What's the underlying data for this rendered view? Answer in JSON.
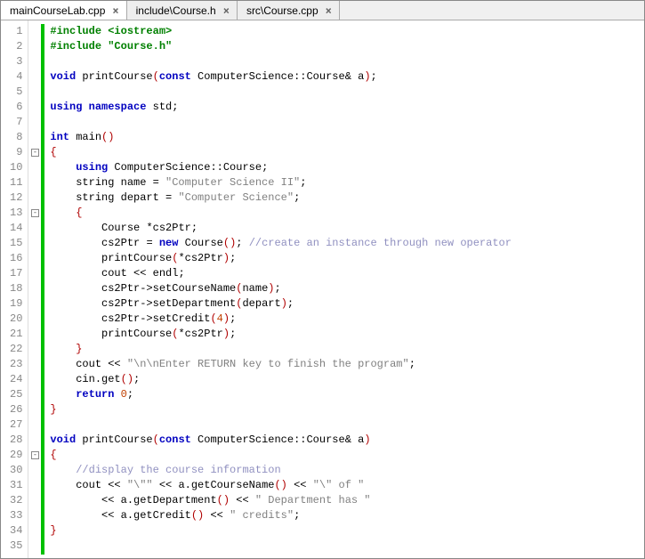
{
  "tabs": [
    {
      "label": "mainCourseLab.cpp",
      "active": true
    },
    {
      "label": "include\\Course.h",
      "active": false
    },
    {
      "label": "src\\Course.cpp",
      "active": false
    }
  ],
  "fold_markers": {
    "9": "-",
    "13": "-",
    "29": "-"
  },
  "code_lines": [
    [
      {
        "c": "tok-pp",
        "t": "#include <iostream>"
      }
    ],
    [
      {
        "c": "tok-pp",
        "t": "#include \"Course.h\""
      }
    ],
    [],
    [
      {
        "c": "tok-kw",
        "t": "void"
      },
      {
        "c": "tok-txt",
        "t": " printCourse"
      },
      {
        "c": "tok-brace",
        "t": "("
      },
      {
        "c": "tok-kw",
        "t": "const"
      },
      {
        "c": "tok-txt",
        "t": " ComputerScience"
      },
      {
        "c": "tok-op",
        "t": "::"
      },
      {
        "c": "tok-txt",
        "t": "Course"
      },
      {
        "c": "tok-op",
        "t": "&"
      },
      {
        "c": "tok-txt",
        "t": " a"
      },
      {
        "c": "tok-brace",
        "t": ")"
      },
      {
        "c": "tok-op",
        "t": ";"
      }
    ],
    [],
    [
      {
        "c": "tok-kw",
        "t": "using"
      },
      {
        "c": "tok-txt",
        "t": " "
      },
      {
        "c": "tok-kw",
        "t": "namespace"
      },
      {
        "c": "tok-txt",
        "t": " std"
      },
      {
        "c": "tok-op",
        "t": ";"
      }
    ],
    [],
    [
      {
        "c": "tok-kw",
        "t": "int"
      },
      {
        "c": "tok-txt",
        "t": " main"
      },
      {
        "c": "tok-brace",
        "t": "()"
      }
    ],
    [
      {
        "c": "tok-brace",
        "t": "{"
      }
    ],
    [
      {
        "c": "tok-txt",
        "t": "    "
      },
      {
        "c": "tok-kw",
        "t": "using"
      },
      {
        "c": "tok-txt",
        "t": " ComputerScience"
      },
      {
        "c": "tok-op",
        "t": "::"
      },
      {
        "c": "tok-txt",
        "t": "Course"
      },
      {
        "c": "tok-op",
        "t": ";"
      }
    ],
    [
      {
        "c": "tok-txt",
        "t": "    string name "
      },
      {
        "c": "tok-op",
        "t": "="
      },
      {
        "c": "tok-txt",
        "t": " "
      },
      {
        "c": "tok-str",
        "t": "\"Computer Science II\""
      },
      {
        "c": "tok-op",
        "t": ";"
      }
    ],
    [
      {
        "c": "tok-txt",
        "t": "    string depart "
      },
      {
        "c": "tok-op",
        "t": "="
      },
      {
        "c": "tok-txt",
        "t": " "
      },
      {
        "c": "tok-str",
        "t": "\"Computer Science\""
      },
      {
        "c": "tok-op",
        "t": ";"
      }
    ],
    [
      {
        "c": "tok-txt",
        "t": "    "
      },
      {
        "c": "tok-brace",
        "t": "{"
      }
    ],
    [
      {
        "c": "tok-txt",
        "t": "        Course "
      },
      {
        "c": "tok-op",
        "t": "*"
      },
      {
        "c": "tok-txt",
        "t": "cs2Ptr"
      },
      {
        "c": "tok-op",
        "t": ";"
      }
    ],
    [
      {
        "c": "tok-txt",
        "t": "        cs2Ptr "
      },
      {
        "c": "tok-op",
        "t": "="
      },
      {
        "c": "tok-txt",
        "t": " "
      },
      {
        "c": "tok-kw",
        "t": "new"
      },
      {
        "c": "tok-txt",
        "t": " Course"
      },
      {
        "c": "tok-brace",
        "t": "()"
      },
      {
        "c": "tok-op",
        "t": ";"
      },
      {
        "c": "tok-txt",
        "t": " "
      },
      {
        "c": "tok-cmt",
        "t": "//create an instance through new operator"
      }
    ],
    [
      {
        "c": "tok-txt",
        "t": "        printCourse"
      },
      {
        "c": "tok-brace",
        "t": "("
      },
      {
        "c": "tok-op",
        "t": "*"
      },
      {
        "c": "tok-txt",
        "t": "cs2Ptr"
      },
      {
        "c": "tok-brace",
        "t": ")"
      },
      {
        "c": "tok-op",
        "t": ";"
      }
    ],
    [
      {
        "c": "tok-txt",
        "t": "        cout "
      },
      {
        "c": "tok-op",
        "t": "<<"
      },
      {
        "c": "tok-txt",
        "t": " endl"
      },
      {
        "c": "tok-op",
        "t": ";"
      }
    ],
    [
      {
        "c": "tok-txt",
        "t": "        cs2Ptr"
      },
      {
        "c": "tok-op",
        "t": "->"
      },
      {
        "c": "tok-txt",
        "t": "setCourseName"
      },
      {
        "c": "tok-brace",
        "t": "("
      },
      {
        "c": "tok-txt",
        "t": "name"
      },
      {
        "c": "tok-brace",
        "t": ")"
      },
      {
        "c": "tok-op",
        "t": ";"
      }
    ],
    [
      {
        "c": "tok-txt",
        "t": "        cs2Ptr"
      },
      {
        "c": "tok-op",
        "t": "->"
      },
      {
        "c": "tok-txt",
        "t": "setDepartment"
      },
      {
        "c": "tok-brace",
        "t": "("
      },
      {
        "c": "tok-txt",
        "t": "depart"
      },
      {
        "c": "tok-brace",
        "t": ")"
      },
      {
        "c": "tok-op",
        "t": ";"
      }
    ],
    [
      {
        "c": "tok-txt",
        "t": "        cs2Ptr"
      },
      {
        "c": "tok-op",
        "t": "->"
      },
      {
        "c": "tok-txt",
        "t": "setCredit"
      },
      {
        "c": "tok-brace",
        "t": "("
      },
      {
        "c": "tok-num",
        "t": "4"
      },
      {
        "c": "tok-brace",
        "t": ")"
      },
      {
        "c": "tok-op",
        "t": ";"
      }
    ],
    [
      {
        "c": "tok-txt",
        "t": "        printCourse"
      },
      {
        "c": "tok-brace",
        "t": "("
      },
      {
        "c": "tok-op",
        "t": "*"
      },
      {
        "c": "tok-txt",
        "t": "cs2Ptr"
      },
      {
        "c": "tok-brace",
        "t": ")"
      },
      {
        "c": "tok-op",
        "t": ";"
      }
    ],
    [
      {
        "c": "tok-txt",
        "t": "    "
      },
      {
        "c": "tok-brace",
        "t": "}"
      }
    ],
    [
      {
        "c": "tok-txt",
        "t": "    cout "
      },
      {
        "c": "tok-op",
        "t": "<<"
      },
      {
        "c": "tok-txt",
        "t": " "
      },
      {
        "c": "tok-str",
        "t": "\"\\n\\nEnter RETURN key to finish the program\""
      },
      {
        "c": "tok-op",
        "t": ";"
      }
    ],
    [
      {
        "c": "tok-txt",
        "t": "    cin"
      },
      {
        "c": "tok-op",
        "t": "."
      },
      {
        "c": "tok-txt",
        "t": "get"
      },
      {
        "c": "tok-brace",
        "t": "()"
      },
      {
        "c": "tok-op",
        "t": ";"
      }
    ],
    [
      {
        "c": "tok-txt",
        "t": "    "
      },
      {
        "c": "tok-kw",
        "t": "return"
      },
      {
        "c": "tok-txt",
        "t": " "
      },
      {
        "c": "tok-num",
        "t": "0"
      },
      {
        "c": "tok-op",
        "t": ";"
      }
    ],
    [
      {
        "c": "tok-brace",
        "t": "}"
      }
    ],
    [],
    [
      {
        "c": "tok-kw",
        "t": "void"
      },
      {
        "c": "tok-txt",
        "t": " printCourse"
      },
      {
        "c": "tok-brace",
        "t": "("
      },
      {
        "c": "tok-kw",
        "t": "const"
      },
      {
        "c": "tok-txt",
        "t": " ComputerScience"
      },
      {
        "c": "tok-op",
        "t": "::"
      },
      {
        "c": "tok-txt",
        "t": "Course"
      },
      {
        "c": "tok-op",
        "t": "&"
      },
      {
        "c": "tok-txt",
        "t": " a"
      },
      {
        "c": "tok-brace",
        "t": ")"
      }
    ],
    [
      {
        "c": "tok-brace",
        "t": "{"
      }
    ],
    [
      {
        "c": "tok-txt",
        "t": "    "
      },
      {
        "c": "tok-cmt",
        "t": "//display the course information"
      }
    ],
    [
      {
        "c": "tok-txt",
        "t": "    cout "
      },
      {
        "c": "tok-op",
        "t": "<<"
      },
      {
        "c": "tok-txt",
        "t": " "
      },
      {
        "c": "tok-str",
        "t": "\"\\\"\""
      },
      {
        "c": "tok-txt",
        "t": " "
      },
      {
        "c": "tok-op",
        "t": "<<"
      },
      {
        "c": "tok-txt",
        "t": " a"
      },
      {
        "c": "tok-op",
        "t": "."
      },
      {
        "c": "tok-txt",
        "t": "getCourseName"
      },
      {
        "c": "tok-brace",
        "t": "()"
      },
      {
        "c": "tok-txt",
        "t": " "
      },
      {
        "c": "tok-op",
        "t": "<<"
      },
      {
        "c": "tok-txt",
        "t": " "
      },
      {
        "c": "tok-str",
        "t": "\"\\\" of \""
      }
    ],
    [
      {
        "c": "tok-txt",
        "t": "        "
      },
      {
        "c": "tok-op",
        "t": "<<"
      },
      {
        "c": "tok-txt",
        "t": " a"
      },
      {
        "c": "tok-op",
        "t": "."
      },
      {
        "c": "tok-txt",
        "t": "getDepartment"
      },
      {
        "c": "tok-brace",
        "t": "()"
      },
      {
        "c": "tok-txt",
        "t": " "
      },
      {
        "c": "tok-op",
        "t": "<<"
      },
      {
        "c": "tok-txt",
        "t": " "
      },
      {
        "c": "tok-str",
        "t": "\" Department has \""
      }
    ],
    [
      {
        "c": "tok-txt",
        "t": "        "
      },
      {
        "c": "tok-op",
        "t": "<<"
      },
      {
        "c": "tok-txt",
        "t": " a"
      },
      {
        "c": "tok-op",
        "t": "."
      },
      {
        "c": "tok-txt",
        "t": "getCredit"
      },
      {
        "c": "tok-brace",
        "t": "()"
      },
      {
        "c": "tok-txt",
        "t": " "
      },
      {
        "c": "tok-op",
        "t": "<<"
      },
      {
        "c": "tok-txt",
        "t": " "
      },
      {
        "c": "tok-str",
        "t": "\" credits\""
      },
      {
        "c": "tok-op",
        "t": ";"
      }
    ],
    [
      {
        "c": "tok-brace",
        "t": "}"
      }
    ],
    []
  ]
}
